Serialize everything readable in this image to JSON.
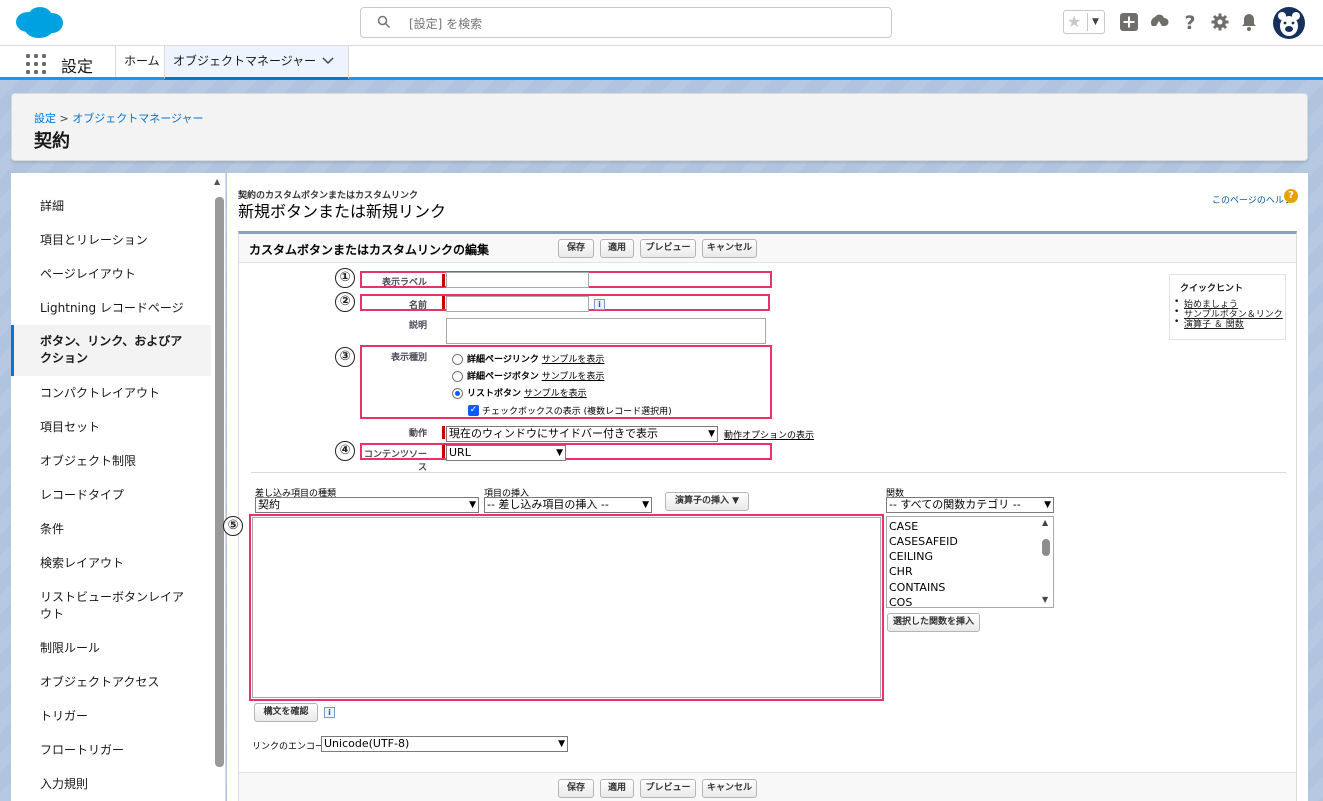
{
  "header": {
    "search_placeholder": "[設定] を検索",
    "avatar": "avatar",
    "icons": [
      "salesforce-cloud-icon",
      "search-icon",
      "star-icon",
      "chevron-down-icon",
      "add-icon",
      "trailhead-icon",
      "help-icon",
      "gear-icon",
      "bell-icon"
    ]
  },
  "context_nav": {
    "app_name": "設定",
    "tabs": [
      {
        "label": "ホーム"
      },
      {
        "label": "オブジェクトマネージャー"
      }
    ]
  },
  "page_header": {
    "breadcrumb_root": "設定",
    "breadcrumb_sep": " > ",
    "breadcrumb_current": "オブジェクトマネージャー",
    "title": "契約"
  },
  "sidebar": {
    "items": [
      {
        "label": "詳細"
      },
      {
        "label": "項目とリレーション"
      },
      {
        "label": "ページレイアウト"
      },
      {
        "label": "Lightning レコードページ"
      },
      {
        "label": "ボタン、リンク、およびア"
      },
      {
        "label": "クション"
      },
      {
        "label": "コンパクトレイアウト"
      },
      {
        "label": "項目セット"
      },
      {
        "label": "オブジェクト制限"
      },
      {
        "label": "レコードタイプ"
      },
      {
        "label": "条件"
      },
      {
        "label": "検索レイアウト"
      },
      {
        "label": "リストビューボタンレイア"
      },
      {
        "label": "ウト"
      },
      {
        "label": "制限ルール"
      },
      {
        "label": "オブジェクトアクセス"
      },
      {
        "label": "トリガー"
      },
      {
        "label": "フロートリガー"
      },
      {
        "label": "入力規則"
      }
    ]
  },
  "main": {
    "subtitle": "契約のカスタムボタンまたはカスタムリンク",
    "title": "新規ボタンまたは新規リンク",
    "help_link": "このページのヘルプ",
    "help_icon": "?",
    "block_title": "カスタムボタンまたはカスタムリンクの編集",
    "buttons": {
      "save": "保存",
      "apply": "適用",
      "preview": "プレビュー",
      "cancel": "キャンセル"
    },
    "fields": {
      "label_label": "表示ラベル",
      "name_label": "名前",
      "desc_label": "説明",
      "display_type_label": "表示種別",
      "behavior_label": "動作",
      "content_source_label": "コンテンツソース"
    },
    "display_types": [
      {
        "bold": "詳細ページリンク",
        "link": "サンプルを表示",
        "selected": false
      },
      {
        "bold": "詳細ページボタン",
        "link": "サンプルを表示",
        "selected": false
      },
      {
        "bold": "リストボタン",
        "link": "サンプルを表示",
        "selected": true
      }
    ],
    "checkbox_label": "チェックボックスの表示 (複数レコード選択用)",
    "behavior_value": "現在のウィンドウにサイドバー付きで表示",
    "behavior_link": "動作オプションの表示",
    "content_source_value": "URL",
    "info_icon": "i",
    "check_mark": "✓",
    "markers": [
      "①",
      "②",
      "③",
      "④",
      "⑤"
    ],
    "quick_hints": {
      "title": "クイックヒント",
      "items": [
        "始めましょう",
        "サンプルボタン＆リンク",
        "演算子 ＆ 関数"
      ]
    },
    "merge": {
      "type_label": "差し込み項目の種類",
      "type_value": "契約",
      "insert_label": "項目の挿入",
      "insert_value": "-- 差し込み項目の挿入 --",
      "operator_button": "演算子の挿入",
      "func_label": "関数",
      "func_value": "-- すべての関数カテゴリ --",
      "functions": [
        "CASE",
        "CASESAFEID",
        "CEILING",
        "CHR",
        "CONTAINS",
        "COS"
      ],
      "insert_func_button": "選択した関数を挿入",
      "check_syntax_button": "構文を確認"
    },
    "encoding_label": "リンクのエンコード",
    "encoding_value": "Unicode(UTF-8)"
  }
}
